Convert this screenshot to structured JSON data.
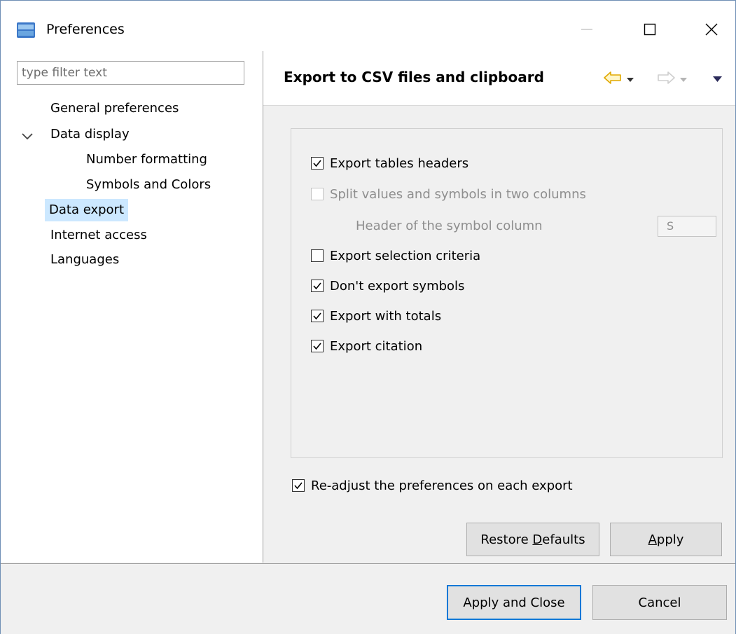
{
  "window": {
    "title": "Preferences"
  },
  "filter": {
    "placeholder": "type filter text"
  },
  "tree": {
    "general": "General preferences",
    "data_display": "Data display",
    "number_formatting": "Number formatting",
    "symbols_colors": "Symbols and Colors",
    "data_export": "Data export",
    "internet_access": "Internet access",
    "languages": "Languages"
  },
  "page": {
    "title": "Export to CSV files and clipboard",
    "options": {
      "export_headers": {
        "label": "Export tables headers",
        "checked": true
      },
      "split_values": {
        "label": "Split values and symbols in two columns",
        "checked": false,
        "disabled": true
      },
      "symbol_header_label": "Header of the symbol column",
      "symbol_header_value": "S",
      "export_criteria": {
        "label": "Export selection criteria",
        "checked": false
      },
      "no_symbols": {
        "label": "Don't export symbols",
        "checked": true
      },
      "totals": {
        "label": "Export with totals",
        "checked": true
      },
      "citation": {
        "label": "Export citation",
        "checked": true
      }
    },
    "readjust": {
      "label": "Re-adjust the preferences on each export",
      "checked": true
    },
    "restore_prefix": "Restore ",
    "restore_mnemonic": "D",
    "restore_suffix": "efaults",
    "apply_mnemonic": "A",
    "apply_suffix": "pply"
  },
  "footer": {
    "apply_close": "Apply and Close",
    "cancel": "Cancel"
  },
  "colors": {
    "accent": "#0078d7",
    "selection": "#cce8ff",
    "nav_arrow": "#f0b400"
  }
}
